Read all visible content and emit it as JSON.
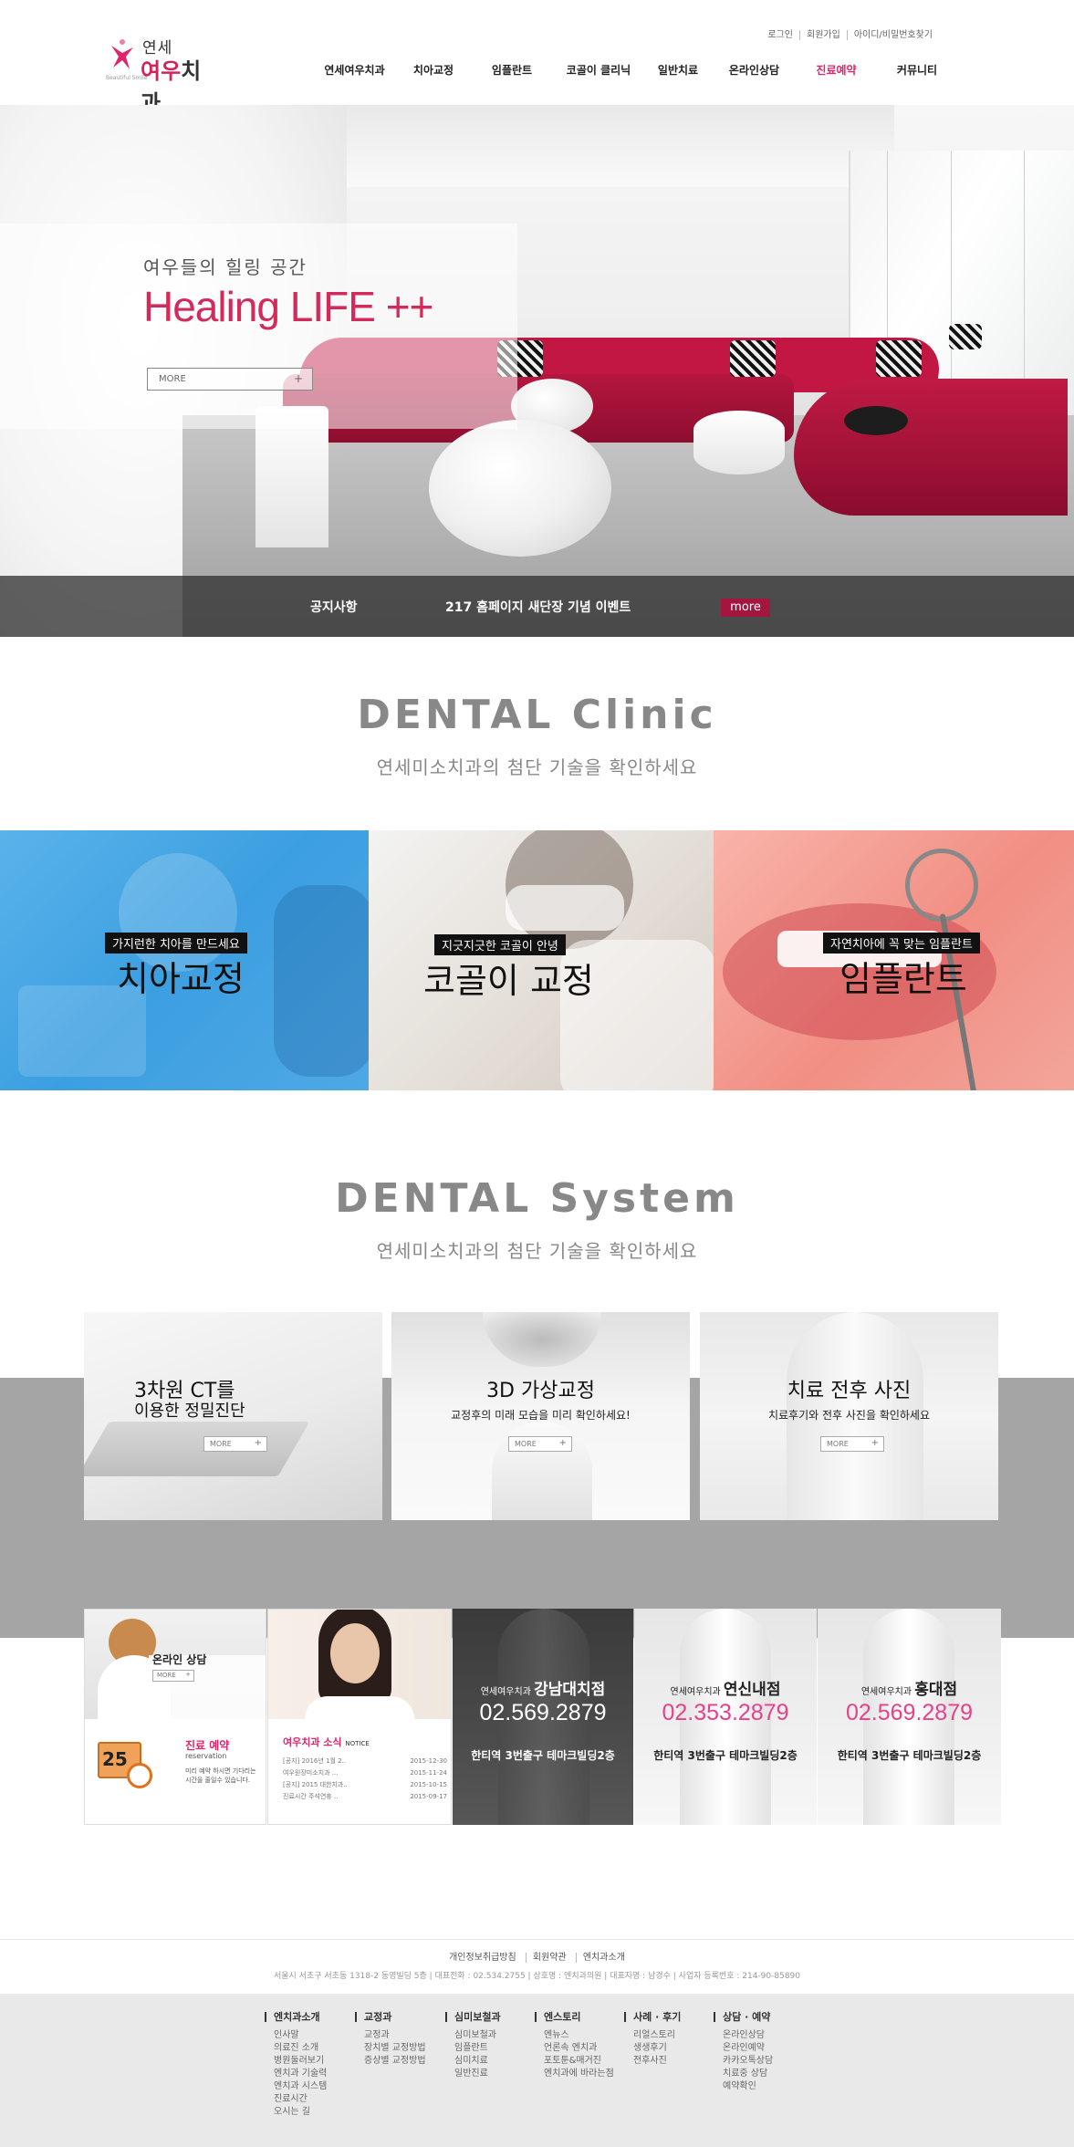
{
  "header": {
    "logo": {
      "top": "연세",
      "brand_pink": "여우",
      "brand_dark": "치과",
      "tagline": "Beautiful Smile"
    },
    "utility": [
      "로그인",
      "회원가입",
      "아이디/비밀번호찾기"
    ],
    "nav": [
      "연세여우치과",
      "치아교정",
      "임플란트",
      "코골이 클리닉",
      "일반치료",
      "온라인상담",
      "진료예약",
      "커뮤니티"
    ],
    "nav_active": "진료예약"
  },
  "hero": {
    "subtitle": "여우들의 힐링 공간",
    "title": "Healing LIFE ++",
    "more": "MORE",
    "plus": "+",
    "notice_label": "공지사항",
    "notice_text": "217 홈페이지 새단장 기념 이벤트",
    "notice_more": "more"
  },
  "clinic_section": {
    "title": "DENTAL Clinic",
    "subtitle": "연세미소치과의 첨단 기술을 확인하세요",
    "cards": [
      {
        "tag": "가지런한 치아를 만드세요",
        "title": "치아교정"
      },
      {
        "tag": "지긋지긋한 코골이 안녕",
        "title": "코골이 교정"
      },
      {
        "tag": "자연치아에 꼭 맞는 임플란트",
        "title": "임플란트"
      }
    ]
  },
  "system_section": {
    "title": "DENTAL System",
    "subtitle": "연세미소치과의 첨단 기술을 확인하세요",
    "cards": [
      {
        "title": "3차원 CT를",
        "desc": "이용한 정밀진단",
        "more": "MORE"
      },
      {
        "title": "3D 가상교정",
        "desc": "교정후의 미래 모습을 미리 확인하세요!",
        "more": "MORE"
      },
      {
        "title": "치료 전후 사진",
        "desc": "치료후기와 전후 사진을 확인하세요",
        "more": "MORE"
      }
    ]
  },
  "consult": {
    "online_title": "온라인 상담",
    "online_more": "MORE",
    "calendar_day": "25",
    "reserve_title": "진료 예약",
    "reserve_en": "reservation",
    "reserve_desc": "미리 예약 하시면 기다리는 시간을 줄일수 있습니다."
  },
  "news": {
    "title": "여우치과 소식",
    "title_en": "NOTICE",
    "items": [
      {
        "text": "[공지] 2016년 1월 2..",
        "date": "2015-12-30"
      },
      {
        "text": "여우원장미소치과 ...",
        "date": "2015-11-24"
      },
      {
        "text": "[공지] 2015 대한치과..",
        "date": "2015-10-15"
      },
      {
        "text": "진료시간 주석연휴 ..",
        "date": "2015-09-17"
      }
    ]
  },
  "branches": [
    {
      "prefix": "연세여우치과",
      "name": "강남대치점",
      "phone": "02.569.2879",
      "addr": "한티역 3번출구 테마크빌딩2층"
    },
    {
      "prefix": "연세여우치과",
      "name": "연신내점",
      "phone": "02.353.2879",
      "addr": "한티역 3번출구 테마크빌딩2층"
    },
    {
      "prefix": "연세여우치과",
      "name": "홍대점",
      "phone": "02.569.2879",
      "addr": "한티역 3번출구 테마크빌딩2층"
    }
  ],
  "footer": {
    "links": [
      "개인정보취급방침",
      "회원약관",
      "엔치과소개"
    ],
    "info": "서울시 서초구 서초동 1318-2 동영빌딩 5층 | 대표전화 : 02.534.2755 | 상호명 : 엔치과의원 | 대표자명 : 남경수 | 사업자 등록번호 : 214-90-85890",
    "columns": [
      {
        "heading": "엔치과소개",
        "items": [
          "인사말",
          "의료진 소개",
          "병원둘러보기",
          "엔치과 기술력",
          "엔치과 시스템",
          "진료시간",
          "오시는 길"
        ]
      },
      {
        "heading": "교정과",
        "items": [
          "교정과",
          "장치별 교정방법",
          "증상별 교정방법"
        ]
      },
      {
        "heading": "심미보철과",
        "items": [
          "심미보철과",
          "임플란트",
          "심미치료",
          "일반진료"
        ]
      },
      {
        "heading": "엔스토리",
        "items": [
          "엔뉴스",
          "언론속 엔치과",
          "포토툰&매거진",
          "엔치과에 바라는점"
        ]
      },
      {
        "heading": "사례 · 후기",
        "items": [
          "리얼스토리",
          "생생후기",
          "전후사진"
        ]
      },
      {
        "heading": "상담 · 예약",
        "items": [
          "온라인상담",
          "온라인예약",
          "카카오톡상담",
          "치료중 상담",
          "예약확인"
        ]
      }
    ]
  },
  "colors": {
    "accent": "#e0256a",
    "notice_more_bg": "#a4163f",
    "pink_phone": "#e64189"
  }
}
